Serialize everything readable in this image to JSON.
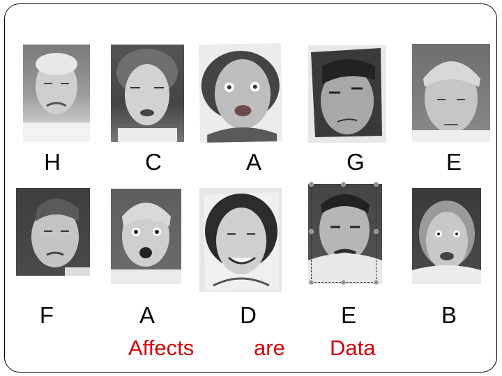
{
  "slide": {
    "top_row": [
      {
        "letter": "H",
        "photo": "face-photo-crying-elderly-man"
      },
      {
        "letter": "C",
        "photo": "face-photo-elderly-woman-curly-hair"
      },
      {
        "letter": "A",
        "photo": "face-photo-surprised-woman"
      },
      {
        "letter": "G",
        "photo": "face-photo-young-man-dark-hair"
      },
      {
        "letter": "E",
        "photo": "face-photo-sad-boy-looking-down"
      }
    ],
    "bottom_row": [
      {
        "letter": "F",
        "photo": "face-photo-disgusted-woman"
      },
      {
        "letter": "A",
        "photo": "face-photo-surprised-boy"
      },
      {
        "letter": "D",
        "photo": "face-photo-smiling-woman"
      },
      {
        "letter": "E",
        "photo": "face-photo-sad-man-looking-down",
        "selected": true
      },
      {
        "letter": "B",
        "photo": "face-photo-frightened-elderly-woman"
      }
    ],
    "caption": [
      "Affects",
      "are",
      "Data"
    ],
    "colors": {
      "caption": "#d40000",
      "letters": "#000000"
    }
  }
}
